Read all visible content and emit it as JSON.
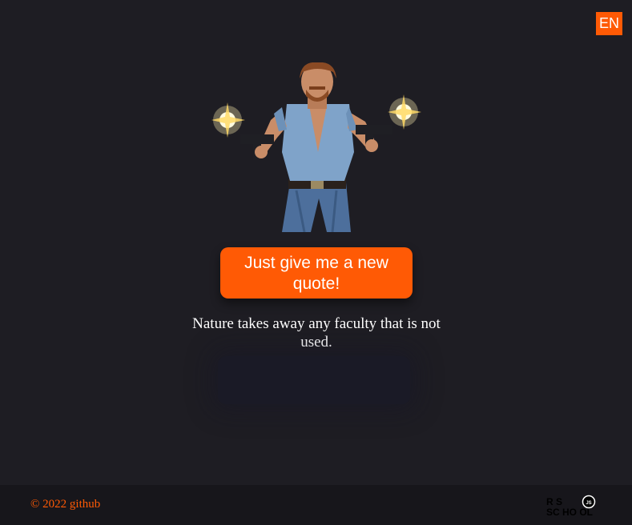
{
  "header": {
    "language_label": "EN"
  },
  "main": {
    "new_quote_button_label": "Just give me a new quote!",
    "quote_text": "Nature takes away any faculty that is not used."
  },
  "footer": {
    "copyright": "© 2022",
    "github_link": "github",
    "rs_logo": {
      "line1": "R S",
      "line2": "SC HO OL",
      "badge": "JS"
    }
  },
  "colors": {
    "background": "#1e1d23",
    "footer_background": "#17161b",
    "accent": "#ff5a05",
    "text": "#ffffff"
  }
}
